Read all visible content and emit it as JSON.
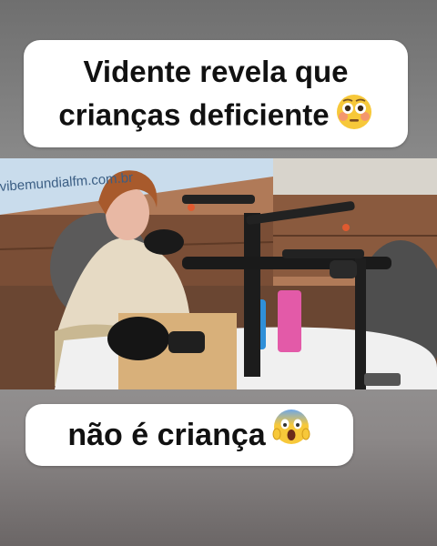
{
  "caption_top": {
    "line1": "Vidente revela que",
    "line2": "crianças deficiente",
    "emoji": "flushed-face-emoji"
  },
  "caption_bottom": {
    "text": "não é criança",
    "emoji": "screaming-face-emoji"
  },
  "video": {
    "wall_sign": "vibemundialfm.com.br"
  },
  "colors": {
    "caption_bg": "#ffffff",
    "caption_text": "#111111",
    "wall_blue": "#c9dcec",
    "panel_brown": "#6e4a33"
  }
}
